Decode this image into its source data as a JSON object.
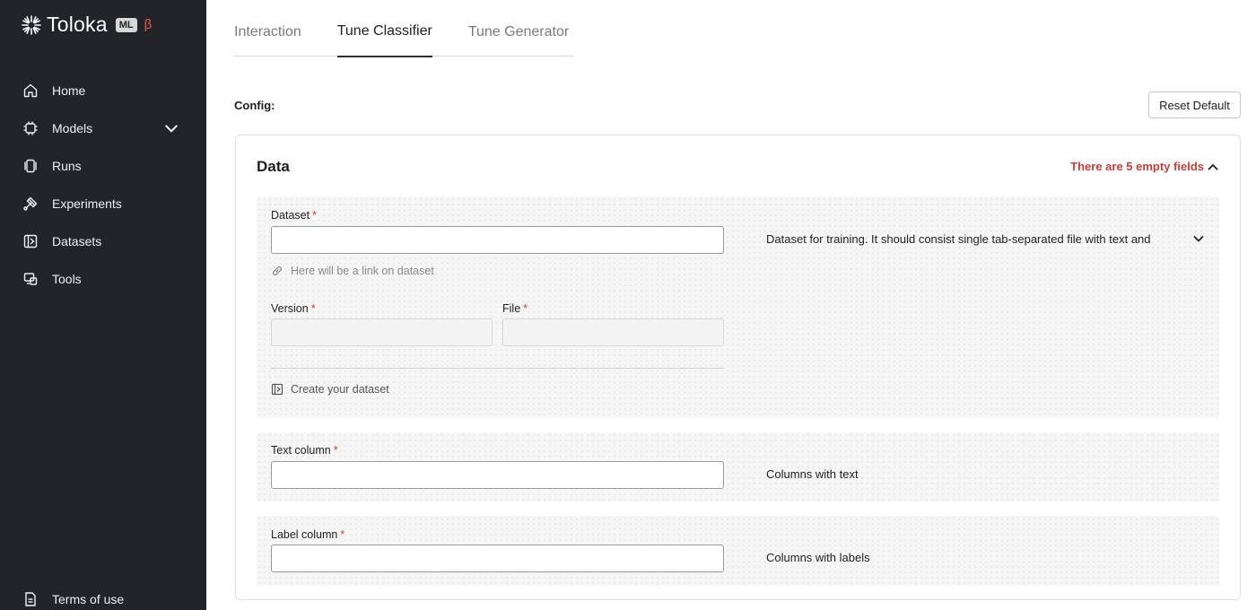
{
  "app": {
    "logo_text": "Toloka",
    "badge": "ML",
    "beta": "β"
  },
  "sidebar": {
    "items": [
      {
        "label": "Home",
        "icon": "home-icon"
      },
      {
        "label": "Models",
        "icon": "chip-icon"
      },
      {
        "label": "Runs",
        "icon": "runs-icon"
      },
      {
        "label": "Experiments",
        "icon": "experiments-icon"
      },
      {
        "label": "Datasets",
        "icon": "datasets-icon"
      },
      {
        "label": "Tools",
        "icon": "tools-icon"
      }
    ],
    "terms_label": "Terms of use"
  },
  "tabs": [
    {
      "label": "Interaction",
      "active": false
    },
    {
      "label": "Tune Classifier",
      "active": true
    },
    {
      "label": "Tune Generator",
      "active": false
    }
  ],
  "config": {
    "label": "Config:",
    "reset_label": "Reset Default"
  },
  "data_section": {
    "title": "Data",
    "warning": "There are 5 empty fields",
    "dataset": {
      "label": "Dataset",
      "required": "*",
      "value": "",
      "hint": "Here will be a link on dataset",
      "description": "Dataset for training. It should consist single tab-separated file with text and",
      "version_label": "Version",
      "file_label": "File",
      "create_label": "Create your dataset"
    },
    "text_column": {
      "label": "Text column",
      "required": "*",
      "value": "",
      "description": "Columns with text"
    },
    "label_column": {
      "label": "Label column",
      "required": "*",
      "value": "",
      "description": "Columns with labels"
    }
  },
  "colors": {
    "sidebar_bg": "#232429",
    "warning": "#d13b33",
    "beta": "#e05a4f"
  }
}
